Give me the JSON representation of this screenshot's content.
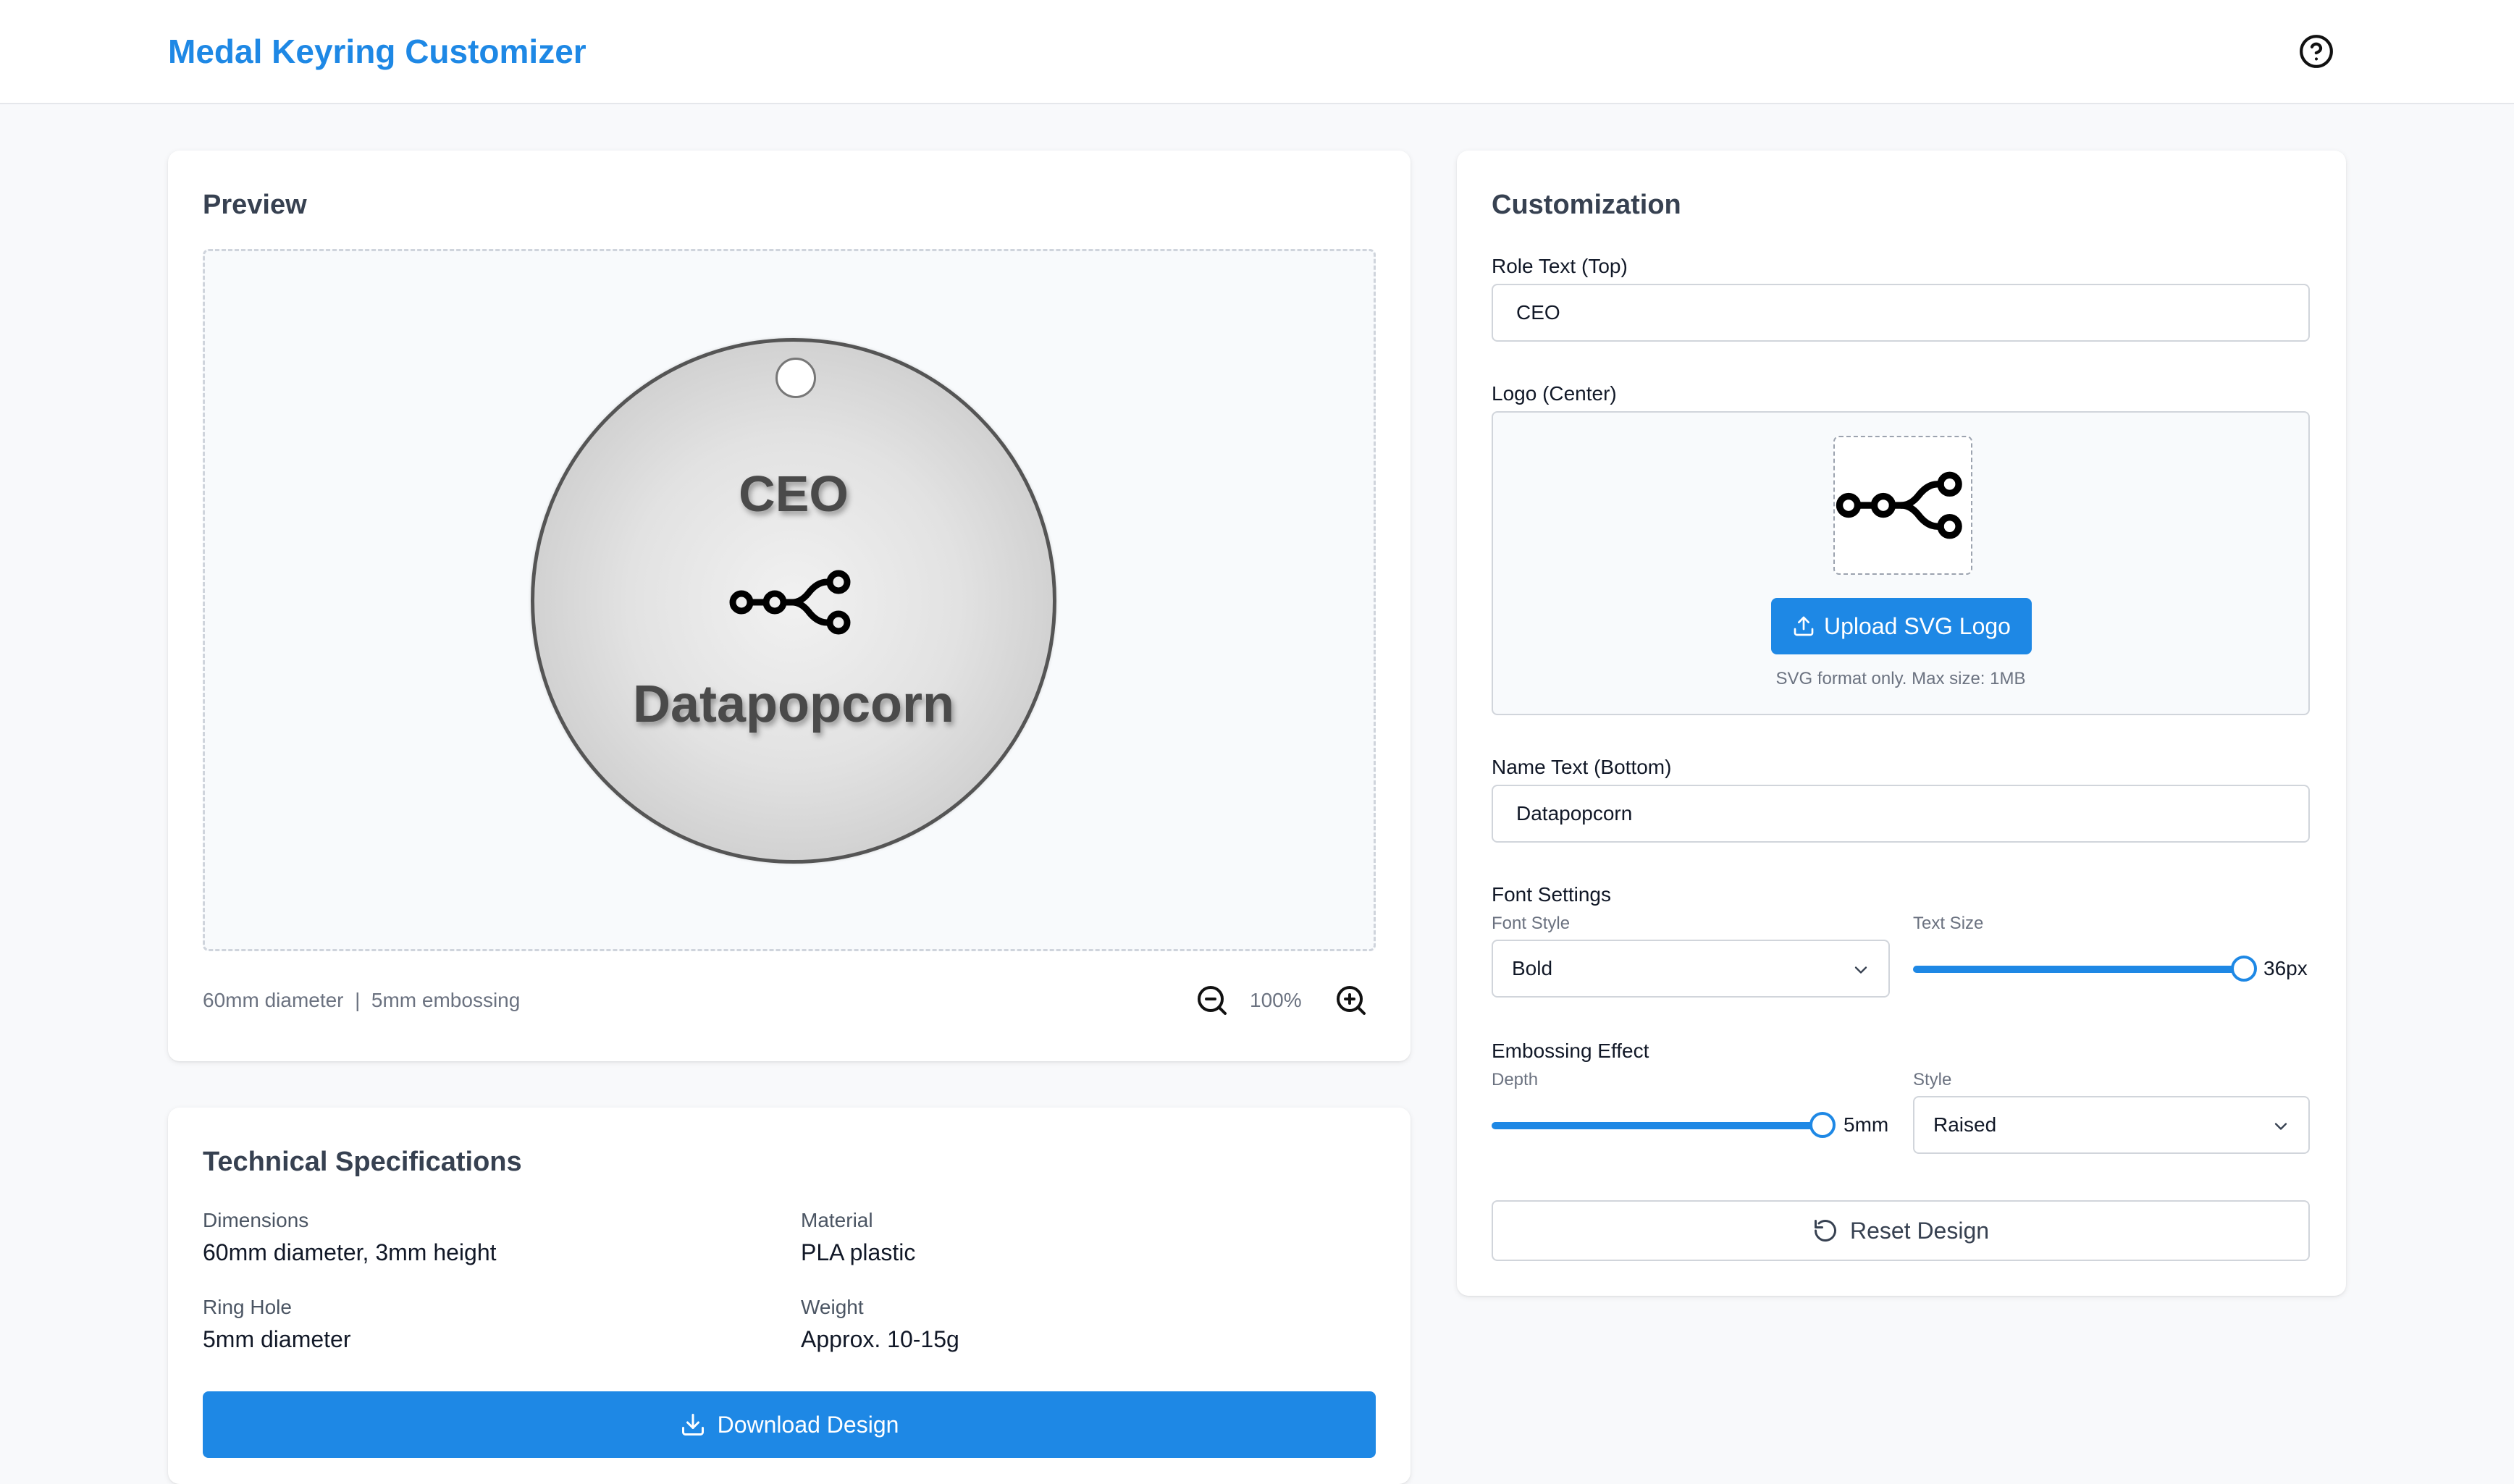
{
  "header": {
    "title": "Medal Keyring Customizer",
    "help_icon": "help-circle-icon"
  },
  "preview": {
    "title": "Preview",
    "medal": {
      "role_text": "CEO",
      "name_text": "Datapopcorn",
      "logo_icon": "workflow-nodes-icon"
    },
    "dimensions_text": "60mm diameter  |  5mm embossing",
    "zoom_level": "100%",
    "zoom_out_icon": "zoom-out-icon",
    "zoom_in_icon": "zoom-in-icon"
  },
  "specs": {
    "title": "Technical Specifications",
    "items": [
      {
        "label": "Dimensions",
        "value": "60mm diameter, 3mm height"
      },
      {
        "label": "Material",
        "value": "PLA plastic"
      },
      {
        "label": "Ring Hole",
        "value": "5mm diameter"
      },
      {
        "label": "Weight",
        "value": "Approx. 10-15g"
      }
    ],
    "download_label": "Download Design",
    "download_icon": "download-icon"
  },
  "customization": {
    "title": "Customization",
    "role_label": "Role Text (Top)",
    "role_value": "CEO",
    "logo_label": "Logo (Center)",
    "upload_label": "Upload SVG Logo",
    "upload_icon": "upload-icon",
    "upload_hint": "SVG format only. Max size: 1MB",
    "name_label": "Name Text (Bottom)",
    "name_value": "Datapopcorn",
    "font_settings_label": "Font Settings",
    "font_style_label": "Font Style",
    "font_style_value": "Bold",
    "text_size_label": "Text Size",
    "text_size_value": "36px",
    "text_size_fraction": 0.99,
    "embossing_label": "Embossing Effect",
    "depth_label": "Depth",
    "depth_value": "5mm",
    "depth_fraction": 0.99,
    "style_label": "Style",
    "style_value": "Raised",
    "reset_label": "Reset Design",
    "reset_icon": "reset-icon"
  },
  "colors": {
    "accent": "#1e88e5",
    "background": "#f8f9fb",
    "card": "#ffffff",
    "medal_border": "#555555"
  }
}
